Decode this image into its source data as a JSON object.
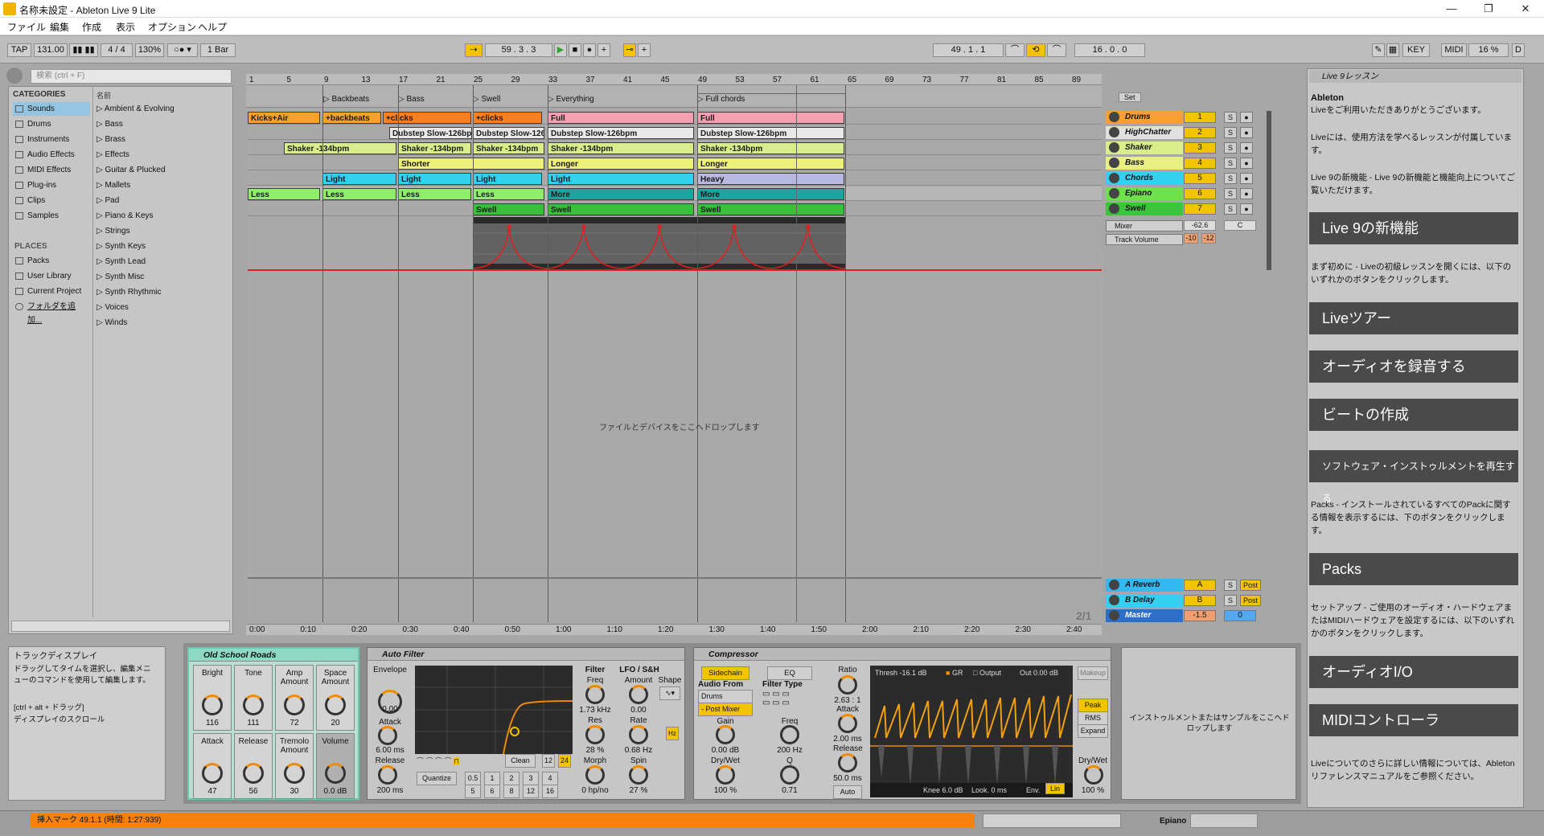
{
  "window": {
    "title": "名称未設定 - Ableton Live 9 Lite",
    "minimize": "—",
    "maximize": "❐",
    "close": "✕"
  },
  "menu": [
    "ファイル",
    "編集",
    "作成",
    "表示",
    "オプション",
    "ヘルプ"
  ],
  "transport": {
    "tap": "TAP",
    "tempo": "131.00",
    "signature": "4 / 4",
    "zoom": "130%",
    "quantize": "1 Bar",
    "position": "59 .  3 .  3",
    "loop_start": "49 .  1 .  1",
    "loop_length": "16 .  0 .  0",
    "key": "KEY",
    "midi": "MIDI",
    "cpu": "16 %",
    "d": "D"
  },
  "browser": {
    "search_placeholder": "検索 (ctrl + F)",
    "categories_header": "CATEGORIES",
    "name_header": "名前",
    "categories": [
      "Sounds",
      "Drums",
      "Instruments",
      "Audio Effects",
      "MIDI Effects",
      "Plug-ins",
      "Clips",
      "Samples"
    ],
    "places_header": "PLACES",
    "places": [
      "Packs",
      "User Library",
      "Current Project",
      "フォルダを追加..."
    ],
    "items": [
      "Ambient & Evolving",
      "Bass",
      "Brass",
      "Effects",
      "Guitar & Plucked",
      "Mallets",
      "Pad",
      "Piano & Keys",
      "Strings",
      "Synth Keys",
      "Synth Lead",
      "Synth Misc",
      "Synth Rhythmic",
      "Voices",
      "Winds"
    ]
  },
  "ruler": [
    "1",
    "5",
    "9",
    "13",
    "17",
    "21",
    "25",
    "29",
    "33",
    "37",
    "41",
    "45",
    "49",
    "53",
    "57",
    "61",
    "65",
    "69",
    "73",
    "77",
    "81",
    "85",
    "89"
  ],
  "locators": [
    "Backbeats",
    "Bass",
    "Swell",
    "Everything",
    "Full chords"
  ],
  "tracks": [
    {
      "name": "Drums",
      "num": "1",
      "color": "#f7a030",
      "clips": [
        "Kicks+Air",
        "+backbeats",
        "+clicks",
        "+clicks",
        "Full",
        "Full"
      ]
    },
    {
      "name": "HighChatter",
      "num": "2",
      "color": "#e0e0e0",
      "clips": [
        "Dubstep Slow-126bpm",
        "Dubstep Slow-126bpm",
        "Dubstep Slow-126bpm",
        "Dubstep Slow-126bpm"
      ]
    },
    {
      "name": "Shaker",
      "num": "3",
      "color": "#d9ee8a",
      "clips": [
        "Shaker -134bpm",
        "Shaker -134bpm",
        "Shaker -134bpm",
        "Shaker -134bpm",
        "Shaker -134bpm"
      ]
    },
    {
      "name": "Bass",
      "num": "4",
      "color": "#e8f080",
      "clips": [
        "Shorter",
        "Longer",
        "Longer"
      ]
    },
    {
      "name": "Chords",
      "num": "5",
      "color": "#33d0f0",
      "clips": [
        "Light",
        "Light",
        "Light",
        "Light",
        "Heavy"
      ]
    },
    {
      "name": "Epiano",
      "num": "6",
      "color": "#6ee04a",
      "clips": [
        "Less",
        "Less",
        "Less",
        "Less",
        "More",
        "More"
      ]
    },
    {
      "name": "Swell",
      "num": "7",
      "color": "#3cc43c",
      "clips": [
        "Swell",
        "Swell",
        "Swell"
      ]
    }
  ],
  "swell_controls": {
    "mixer": "Mixer",
    "track_volume": "Track Volume",
    "value": "-62.6",
    "pan": "C",
    "v1": "-10",
    "v2": "-12"
  },
  "returns": [
    {
      "name": "A Reverb",
      "num": "A",
      "post": "Post"
    },
    {
      "name": "B Delay",
      "num": "B",
      "post": "Post"
    },
    {
      "name": "Master",
      "num": "-1.5",
      "post": "0"
    }
  ],
  "drop_text": "ファイルとデバイスをここへドロップします",
  "page_indicator": "2/1",
  "time_ruler": [
    "0:00",
    "0:10",
    "0:20",
    "0:30",
    "0:40",
    "0:50",
    "1:00",
    "1:10",
    "1:20",
    "1:30",
    "1:40",
    "1:50",
    "2:00",
    "2:10",
    "2:20",
    "2:30",
    "2:40"
  ],
  "info_view": {
    "title": "トラックディスプレイ",
    "body": "ドラッグしてタイムを選択し、編集メニューのコマンドを使用して編集します。",
    "shortcut": "[ctrl + alt + ドラッグ]",
    "shortcut_desc": "ディスプレイのスクロール"
  },
  "device_rack": {
    "name": "Old School Roads",
    "macros": [
      {
        "label": "Bright",
        "value": "116"
      },
      {
        "label": "Tone",
        "value": "111"
      },
      {
        "label": "Amp Amount",
        "value": "72"
      },
      {
        "label": "Space Amount",
        "value": "20"
      },
      {
        "label": "Attack",
        "value": "47"
      },
      {
        "label": "Release",
        "value": "56"
      },
      {
        "label": "Tremolo Amount",
        "value": "30"
      },
      {
        "label": "Volume",
        "value": "0.0 dB"
      }
    ]
  },
  "auto_filter": {
    "name": "Auto Filter",
    "envelope": "Envelope",
    "env_val": "0.00",
    "attack": "Attack",
    "attack_val": "6.00 ms",
    "release": "Release",
    "release_val": "200 ms",
    "filter": "Filter",
    "freq": "Freq",
    "freq_val": "1.73 kHz",
    "res": "Res",
    "res_val": "28 %",
    "morph": "Morph",
    "morph_val": "0 hp/no",
    "lfo": "LFO / S&H",
    "amount": "Amount",
    "amount_val": "0.00",
    "rate": "Rate",
    "rate_val": "0.68 Hz",
    "spin": "Spin",
    "spin_val": "27 %",
    "shape": "Shape",
    "clean": "Clean",
    "quantize": "Quantize",
    "q1": "0.5",
    "q_vals": [
      "1",
      "2",
      "3",
      "4",
      "5",
      "6",
      "8",
      "12",
      "16"
    ],
    "n12": "12",
    "n24": "24",
    "hz": "Hz"
  },
  "compressor": {
    "name": "Compressor",
    "sidechain": "Sidechain",
    "eq": "EQ",
    "audio_from": "Audio From",
    "source": "Drums",
    "post": "- Post Mixer",
    "gain": "Gain",
    "gain_val": "0.00 dB",
    "drywet": "Dry/Wet",
    "drywet_val": "100 %",
    "filter_type": "Filter Type",
    "freq": "Freq",
    "freq_val": "200 Hz",
    "q": "Q",
    "q_val": "0.71",
    "ratio": "Ratio",
    "ratio_val": "2.63 : 1",
    "attack": "Attack",
    "attack_val": "2.00 ms",
    "release": "Release",
    "release_val": "50.0 ms",
    "auto": "Auto",
    "thresh": "Thresh -16.1 dB",
    "gr": "GR",
    "output": "Output",
    "out": "Out 0.00 dB",
    "knee": "Knee 6.0 dB",
    "look": "Look. 0 ms",
    "env": "Env.",
    "lin": "Lin",
    "makeup": "Makeup",
    "peak": "Peak",
    "rms": "RMS",
    "expand": "Expand",
    "drywet2": "Dry/Wet",
    "drywet2_val": "100 %"
  },
  "drop_instrument": "インストゥルメントまたはサンプルをここへドロップします",
  "help": {
    "panel_title": "Live 9レッスン",
    "heading": "Ableton",
    "p1": "Liveをご利用いただきありがとうございます。",
    "p2": "Liveには、使用方法を学べるレッスンが付属しています。",
    "p3": "Live 9の新機能 - Live 9の新機能と機能向上についてご覧いただけます。",
    "b1": "Live 9の新機能",
    "p4": "まず初めに - Liveの初級レッスンを開くには、以下のいずれかのボタンをクリックします。",
    "b2": "Liveツアー",
    "b3": "オーディオを録音する",
    "b4": "ビートの作成",
    "b5": "ソフトウェア・インストゥルメントを再生する",
    "p5": "Packs - インストールされているすべてのPackに関する情報を表示するには、下のボタンをクリックします。",
    "b6": "Packs",
    "p6": "セットアップ - ご使用のオーディオ・ハードウェアまたはMIDIハードウェアを設定するには、以下のいずれかのボタンをクリックします。",
    "b7": "オーディオI/O",
    "b8": "MIDIコントローラ",
    "p7": "Liveについてのさらに詳しい情報については、Abletonリファレンスマニュアルをご参照ください。"
  },
  "status": {
    "text": "挿入マーク 49.1.1 (時間: 1:27:939)",
    "track": "Epiano"
  }
}
